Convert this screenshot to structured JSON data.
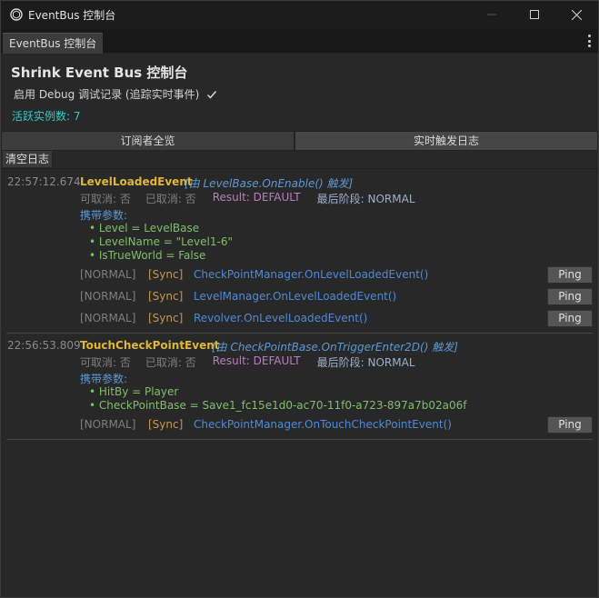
{
  "window": {
    "title": "EventBus 控制台",
    "buttons": [
      "minimize",
      "maximize",
      "close"
    ]
  },
  "tab": {
    "label": "EventBus 控制台"
  },
  "header": {
    "title": "Shrink Event Bus 控制台",
    "debug_label": "启用 Debug 调试记录 (追踪实时事件)",
    "debug_checked": true,
    "active_instances": "活跃实例数: 7"
  },
  "toolbar": {
    "tab_subscribers": "订阅者全览",
    "tab_realtime": "实时触发日志",
    "clear_label": "清空日志"
  },
  "colors": {
    "event_name": "#e0b73a",
    "trigger": "#5a9ad6",
    "param": "#7fbf6a",
    "sync": "#c99a45",
    "method": "#4f8ad6",
    "result": "#b97fbf",
    "active": "#35c9c9"
  },
  "entries": [
    {
      "time": "22:57:12.674",
      "event": "LevelLoadedEvent",
      "trigger": "[由 LevelBase.OnEnable() 触发]",
      "cancelable": "可取消: 否",
      "canceled": "已取消: 否",
      "result": "Result: DEFAULT",
      "phase": "最后阶段: NORMAL",
      "params_label": "携带参数:",
      "params": [
        "• Level = LevelBase",
        "• LevelName = \"Level1-6\"",
        "• IsTrueWorld = False"
      ],
      "subscribers": [
        {
          "phase": "[NORMAL]",
          "mode": "[Sync]",
          "method": "CheckPointManager.OnLevelLoadedEvent()",
          "ping": "Ping"
        },
        {
          "phase": "[NORMAL]",
          "mode": "[Sync]",
          "method": "LevelManager.OnLevelLoadedEvent()",
          "ping": "Ping"
        },
        {
          "phase": "[NORMAL]",
          "mode": "[Sync]",
          "method": "Revolver.OnLevelLoadedEvent()",
          "ping": "Ping"
        }
      ]
    },
    {
      "time": "22:56:53.809",
      "event": "TouchCheckPointEvent",
      "trigger": "[由 CheckPointBase.OnTriggerEnter2D() 触发]",
      "cancelable": "可取消: 否",
      "canceled": "已取消: 否",
      "result": "Result: DEFAULT",
      "phase": "最后阶段: NORMAL",
      "params_label": "携带参数:",
      "params": [
        "• HitBy = Player",
        "• CheckPointBase = Save1_fc15e1d0-ac70-11f0-a723-897a7b02a06f"
      ],
      "subscribers": [
        {
          "phase": "[NORMAL]",
          "mode": "[Sync]",
          "method": "CheckPointManager.OnTouchCheckPointEvent()",
          "ping": "Ping"
        }
      ]
    }
  ]
}
